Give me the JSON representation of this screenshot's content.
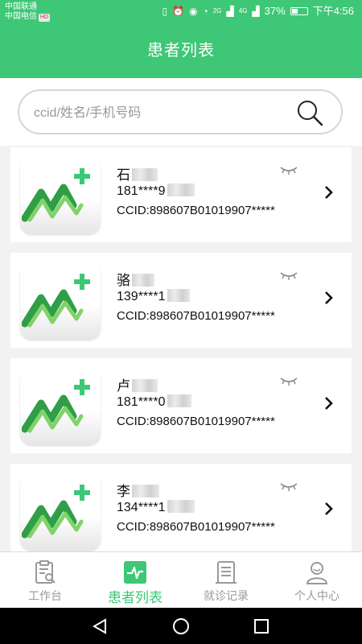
{
  "statusbar": {
    "carrier1": "中国联通",
    "carrier2": "中国电信",
    "badge": "HD",
    "network1": "2G",
    "network2": "4G",
    "battery": "37%",
    "time": "下午4:56"
  },
  "header": {
    "title": "患者列表"
  },
  "search": {
    "placeholder": "ccid/姓名/手机号码"
  },
  "patients": [
    {
      "surname": "石",
      "phone": "181****9",
      "ccid": "CCID:898607B01019907*****"
    },
    {
      "surname": "骆",
      "phone": "139****1",
      "ccid": "CCID:898607B01019907*****"
    },
    {
      "surname": "卢",
      "phone": "181****0",
      "ccid": "CCID:898607B01019907*****"
    },
    {
      "surname": "李",
      "phone": "134****1",
      "ccid": "CCID:898607B01019907*****"
    }
  ],
  "tabs": [
    {
      "label": "工作台",
      "icon": "clipboard-search-icon",
      "active": false
    },
    {
      "label": "患者列表",
      "icon": "heartbeat-icon",
      "active": true
    },
    {
      "label": "就诊记录",
      "icon": "document-list-icon",
      "active": false
    },
    {
      "label": "个人中心",
      "icon": "person-icon",
      "active": false
    }
  ],
  "colors": {
    "primary": "#3ec776",
    "tab_inactive": "#999999",
    "logo_green": "#3aa64a"
  }
}
